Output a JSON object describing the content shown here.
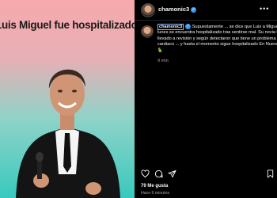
{
  "post": {
    "image_title": "Luis Miguel fue hospitalizado"
  },
  "header": {
    "username": "chamonic3",
    "verified_mark": "✓",
    "more": "•••"
  },
  "caption": {
    "username": "chamonic3",
    "text": " Supuestamente ... se dice que Luis a Miguel el día lunes se encuentra hospitalizado tras sentirse mal. Su novia lo abría llevado a revisión y según detectaron que tiene un problema cardiaco ... y hasta el momento sigue hospitalizado En Nueva York 🦜",
    "time": "9 min"
  },
  "footer": {
    "likes": "79 Me gusta",
    "time": "Hace 9 minutos"
  },
  "icons": {
    "like": "heart-icon",
    "comment": "comment-icon",
    "share": "share-icon",
    "save": "bookmark-icon"
  },
  "colors": {
    "verified": "#3897f0",
    "background": "#000000"
  }
}
